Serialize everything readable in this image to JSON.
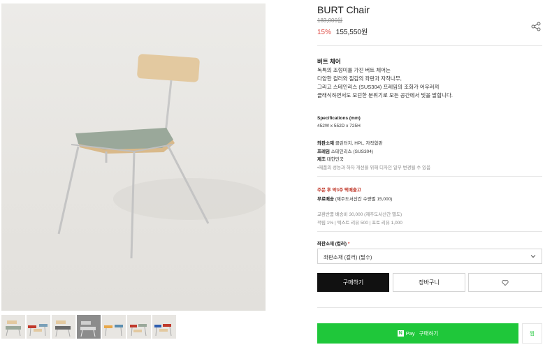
{
  "product": {
    "title": "BURT Chair",
    "original_price": "183,000원",
    "discount": "15%",
    "price": "155,550원",
    "share_icon": "share-icon"
  },
  "description": {
    "title": "버트 체어",
    "lines": [
      "독특의 조형미를 가진 버트 체어는",
      "다양한 컬러와 질감의 좌판과 자작나무,",
      "그리고 스테인리스 (SUS304) 프레임의 조화가 어우러져",
      "클래식하면서도 모던한 분위기로 모든 공간에서 빛을 발합니다."
    ]
  },
  "specifications": {
    "title": "Specifications (mm)",
    "size": "452W x 552D x 725H",
    "materials": [
      {
        "label": "좌판소재",
        "value": "클린터치, HPL, 자작합판"
      },
      {
        "label": "프레임",
        "value": "스테인리스 (SUS304)"
      },
      {
        "label": "제조",
        "value": "대한민국"
      }
    ],
    "notice": "•제품의 성능과 하자 개선을 위해 디자인 일부 변경될 수 있음"
  },
  "shipping": {
    "lead_time": "주문 후 약3주 택배출고",
    "free_label": "무료배송",
    "free_detail": "(제주도서산간 수량별 15,000)",
    "exchange": "교환반품 배송비 30,000 (제주도서산간 별도)",
    "points": "적립 1% | 텍스트 리뷰 500 | 포토 리뷰 1,000"
  },
  "option": {
    "label": "좌판소재 (컬러)",
    "required_mark": "*",
    "selected": "좌판소재 (컬러) (필수)"
  },
  "buttons": {
    "buy": "구매하기",
    "cart": "장바구니",
    "wishlist_icon": "heart-icon"
  },
  "npay": {
    "logo": "N",
    "label": "Pay",
    "action": "구매하기",
    "side": "찜"
  },
  "thumbnails": [
    "thumb-1",
    "thumb-2",
    "thumb-3",
    "thumb-4",
    "thumb-5",
    "thumb-6",
    "thumb-7"
  ],
  "colors": {
    "accent_red": "#e0504a",
    "npay_green": "#1fc73a",
    "buy_black": "#111111",
    "seat_sage": "#9aa89a",
    "backrest_wood": "#e3c9a0"
  }
}
